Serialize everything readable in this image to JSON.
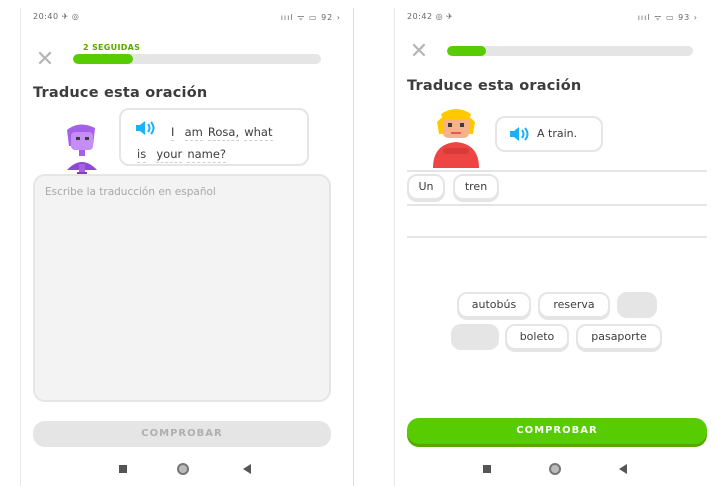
{
  "left": {
    "status_time": "20:40 ✈ ◎",
    "status_icons": "ıııl ᯤ ▭ 92 ›",
    "streak": "2 SEGUIDAS",
    "progress": 0.24,
    "title": "Traduce esta oración",
    "bubble_words_line1": [
      "I",
      "am",
      "Rosa,",
      "what"
    ],
    "bubble_words_line2": [
      "is",
      "your",
      "name?"
    ],
    "textarea_placeholder": "Escribe la traducción en español",
    "check_label": "COMPROBAR"
  },
  "right": {
    "status_time": "20:42 ◎ ✈",
    "status_icons": "ıııl ᯤ ▭ 93 ›",
    "progress": 0.16,
    "title": "Traduce esta oración",
    "bubble_text": "A train.",
    "answer_words": [
      "Un",
      "tren"
    ],
    "bank_row1": [
      "autobús",
      "reserva",
      ""
    ],
    "bank_row2": [
      "",
      "boleto",
      "pasaporte"
    ],
    "check_label": "COMPROBAR"
  },
  "colors": {
    "green": "#58cc02",
    "speaker_blue": "#1cb0f6",
    "disabled": "#e5e5e5"
  }
}
